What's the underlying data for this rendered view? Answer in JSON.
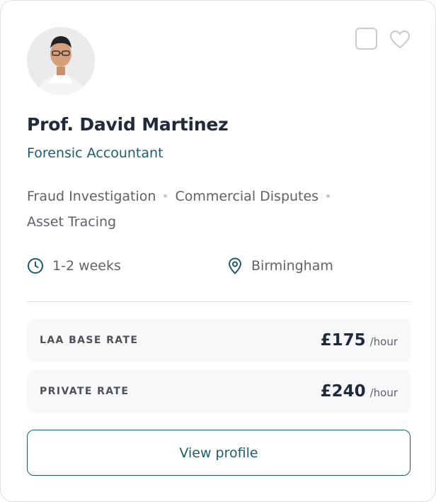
{
  "profile": {
    "name": "Prof. David Martinez",
    "role": "Forensic Accountant",
    "specialisms": [
      "Fraud Investigation",
      "Commercial Disputes",
      "Asset Tracing"
    ],
    "availability": "1-2 weeks",
    "location": "Birmingham"
  },
  "rates": [
    {
      "label": "LAA BASE RATE",
      "amount": "£175",
      "unit": "/hour"
    },
    {
      "label": "PRIVATE RATE",
      "amount": "£240",
      "unit": "/hour"
    }
  ],
  "actions": {
    "view_profile_label": "View profile"
  },
  "icons": {
    "select": "checkbox-icon",
    "favorite": "heart-icon",
    "availability": "clock-icon",
    "location": "map-pin-icon"
  },
  "colors": {
    "name": "#1f2a3d",
    "accent": "#1e5c6b",
    "muted_text": "#5e6369",
    "rate_background": "#f7f8fa",
    "border": "#dcdfe3"
  }
}
